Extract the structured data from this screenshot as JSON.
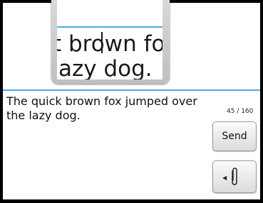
{
  "magnifier": {
    "line1": "t brown fox",
    "line2": "azy dog."
  },
  "compose": {
    "message": "The quick brown fox jumped over the lazy dog.",
    "counter": "45 / 160",
    "send_label": "Send",
    "attach_icon": "paperclip-icon"
  },
  "colors": {
    "accent": "#44aee3",
    "frame": "#000000"
  }
}
